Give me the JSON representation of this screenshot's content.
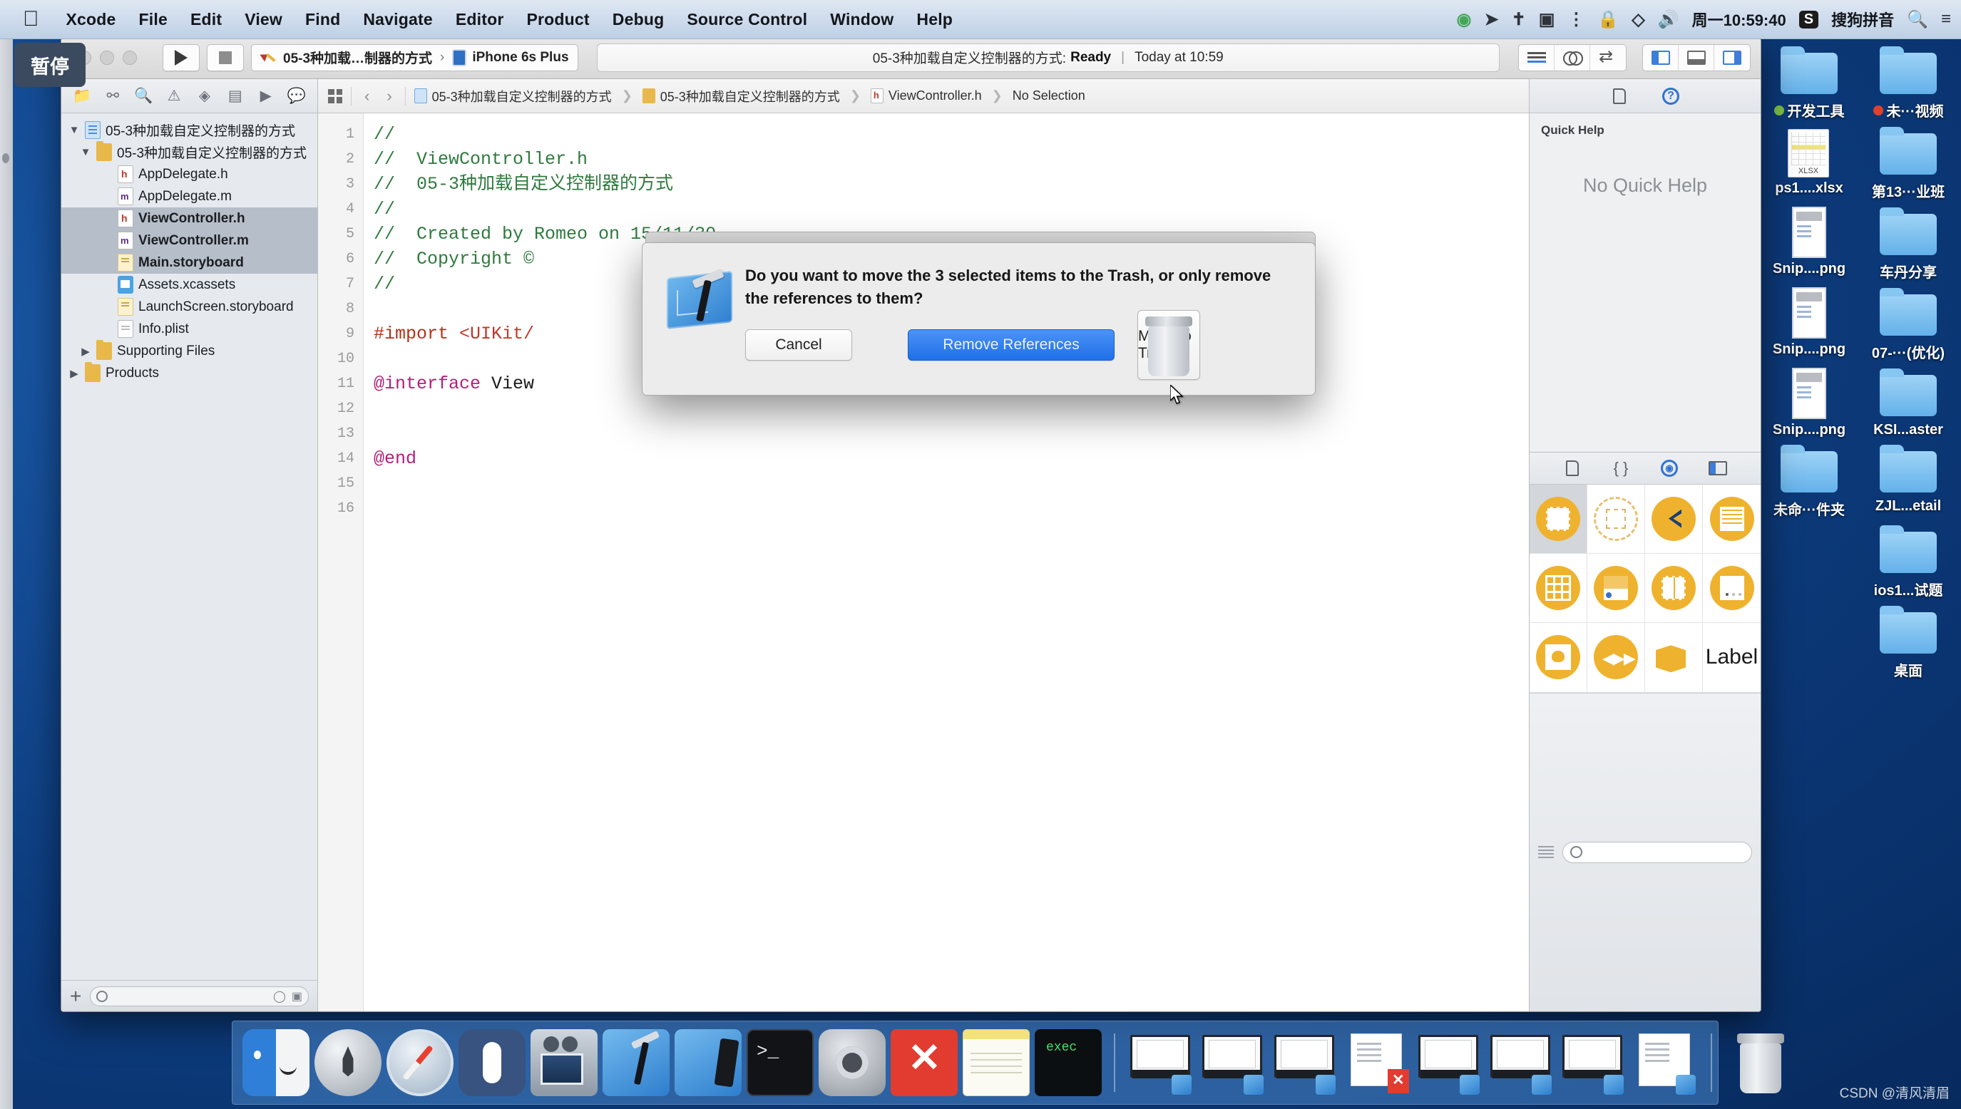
{
  "menubar": {
    "apple_glyph": "",
    "items": [
      "Xcode",
      "File",
      "Edit",
      "View",
      "Find",
      "Navigate",
      "Editor",
      "Product",
      "Debug",
      "Source Control",
      "Window",
      "Help"
    ],
    "status": {
      "record_icon": "record-green-icon",
      "location_icon": "location-arrow-icon",
      "bluetooth_icon": "bluetooth-icon",
      "screenrec_icon": "screen-record-icon",
      "airplay_icon": "airplay-icon",
      "lock_icon": "lock-icon",
      "shield_icon": "shield-icon",
      "volume_icon": "volume-icon",
      "clock": "周一10:59:40",
      "ime_badge": "S",
      "ime_label": "搜狗拼音",
      "search_icon": "search-icon",
      "control_center_icon": "list-icon"
    }
  },
  "pause_badge": {
    "label": "暂停"
  },
  "xcode": {
    "toolbar": {
      "run_icon": "play-triangle-icon",
      "stop_icon": "stop-square-icon",
      "scheme_name": "05-3种加载…制器的方式",
      "scheme_chevron": "›",
      "destination": "iPhone 6s Plus",
      "status_project": "05-3种加载自定义控制器的方式:",
      "status_state": "Ready",
      "status_divider": "|",
      "status_time": "Today at 10:59",
      "editor_standard_icon": "standard-editor-icon",
      "editor_assistant_icon": "assistant-editor-icon",
      "editor_version_icon": "version-editor-icon",
      "toggle_navigator_icon": "toggle-navigator-icon",
      "toggle_debug_icon": "toggle-debug-area-icon",
      "toggle_utilities_icon": "toggle-utilities-icon"
    },
    "navigator": {
      "tabs": [
        "folder-icon",
        "source-control-icon",
        "search-icon",
        "warning-triangle-icon",
        "test-diamond-icon",
        "debug-icon",
        "breakpoint-tag-icon",
        "report-icon"
      ],
      "tree": [
        {
          "label": "05-3种加载自定义控制器的方式",
          "indent": 0,
          "icon": "project",
          "twisty": "▼",
          "selected": false
        },
        {
          "label": "05-3种加载自定义控制器的方式",
          "indent": 1,
          "icon": "folder",
          "twisty": "▼",
          "selected": false
        },
        {
          "label": "AppDelegate.h",
          "indent": 2,
          "icon": "header",
          "twisty": "",
          "selected": false
        },
        {
          "label": "AppDelegate.m",
          "indent": 2,
          "icon": "impl",
          "twisty": "",
          "selected": false
        },
        {
          "label": "ViewController.h",
          "indent": 2,
          "icon": "header",
          "twisty": "",
          "selected": true
        },
        {
          "label": "ViewController.m",
          "indent": 2,
          "icon": "impl",
          "twisty": "",
          "selected": true
        },
        {
          "label": "Main.storyboard",
          "indent": 2,
          "icon": "storyboard",
          "twisty": "",
          "selected": true
        },
        {
          "label": "Assets.xcassets",
          "indent": 2,
          "icon": "xcassets",
          "twisty": "",
          "selected": false
        },
        {
          "label": "LaunchScreen.storyboard",
          "indent": 2,
          "icon": "storyboard",
          "twisty": "",
          "selected": false
        },
        {
          "label": "Info.plist",
          "indent": 2,
          "icon": "plist",
          "twisty": "",
          "selected": false
        },
        {
          "label": "Supporting Files",
          "indent": 1,
          "icon": "folder",
          "twisty": "▶",
          "selected": false
        },
        {
          "label": "Products",
          "indent": 0,
          "icon": "folder",
          "twisty": "▶",
          "selected": false
        }
      ],
      "footer": {
        "add_label": "+",
        "filter_placeholder": "",
        "recent_icon": "clock-icon",
        "source_icon": "source-control-filter-icon"
      }
    },
    "jumpbar": {
      "grid_icon": "related-items-icon",
      "back_icon": "‹",
      "forward_icon": "›",
      "crumbs": [
        "05-3种加载自定义控制器的方式",
        "05-3种加载自定义控制器的方式",
        "ViewController.h",
        "No Selection"
      ],
      "separator": "❯"
    },
    "code": {
      "filename": "ViewController.h",
      "lines": [
        {
          "n": 1,
          "segments": [
            {
              "t": "//",
              "c": "c-cmt"
            }
          ]
        },
        {
          "n": 2,
          "segments": [
            {
              "t": "//  ViewController.h",
              "c": "c-cmt"
            }
          ]
        },
        {
          "n": 3,
          "segments": [
            {
              "t": "//  05-3种加载自定义控制器的方式",
              "c": "c-cmt"
            }
          ]
        },
        {
          "n": 4,
          "segments": [
            {
              "t": "//",
              "c": "c-cmt"
            }
          ]
        },
        {
          "n": 5,
          "segments": [
            {
              "t": "//  Created by Romeo on 15/11/30",
              "c": "c-cmt"
            }
          ]
        },
        {
          "n": 6,
          "segments": [
            {
              "t": "//  Copyright ©",
              "c": "c-cmt"
            }
          ]
        },
        {
          "n": 7,
          "segments": [
            {
              "t": "//",
              "c": "c-cmt"
            }
          ]
        },
        {
          "n": 8,
          "segments": [
            {
              "t": "",
              "c": "c-txt"
            }
          ]
        },
        {
          "n": 9,
          "segments": [
            {
              "t": "#import ",
              "c": "c-pre"
            },
            {
              "t": "<UIKit/",
              "c": "c-str"
            }
          ]
        },
        {
          "n": 10,
          "segments": [
            {
              "t": "",
              "c": "c-txt"
            }
          ]
        },
        {
          "n": 11,
          "segments": [
            {
              "t": "@interface ",
              "c": "c-kw"
            },
            {
              "t": "View",
              "c": "c-txt"
            }
          ]
        },
        {
          "n": 12,
          "segments": [
            {
              "t": "",
              "c": "c-txt"
            }
          ]
        },
        {
          "n": 13,
          "segments": [
            {
              "t": "",
              "c": "c-txt"
            }
          ]
        },
        {
          "n": 14,
          "segments": [
            {
              "t": "@end",
              "c": "c-kw"
            }
          ]
        },
        {
          "n": 15,
          "segments": [
            {
              "t": "",
              "c": "c-txt"
            }
          ]
        },
        {
          "n": 16,
          "segments": [
            {
              "t": "",
              "c": "c-txt"
            }
          ]
        }
      ]
    },
    "utilities": {
      "tabs": [
        "file-inspector-icon",
        "quick-help-icon"
      ],
      "quick_help_title": "Quick Help",
      "quick_help_empty": "No Quick Help",
      "library_tabs": [
        "file-template-library-icon",
        "code-snippet-library-icon",
        "object-library-icon",
        "media-library-icon"
      ],
      "library_objects": [
        {
          "name": "view-controller-object",
          "kind": "viewctrl",
          "selected": true
        },
        {
          "name": "storyboard-reference-object",
          "kind": "dashed",
          "selected": false
        },
        {
          "name": "navigation-controller-object",
          "kind": "navctrl",
          "selected": false
        },
        {
          "name": "table-view-controller-object",
          "kind": "tablectrl",
          "selected": false
        },
        {
          "name": "collection-view-controller-object",
          "kind": "collection",
          "selected": false
        },
        {
          "name": "tab-bar-controller-object",
          "kind": "tabbar",
          "selected": false
        },
        {
          "name": "split-view-controller-object",
          "kind": "split",
          "selected": false
        },
        {
          "name": "page-view-controller-object",
          "kind": "pagectl",
          "selected": false
        },
        {
          "name": "image-view-object",
          "kind": "imageview",
          "selected": false
        },
        {
          "name": "av-player-object",
          "kind": "player",
          "selected": false
        },
        {
          "name": "object-cube",
          "kind": "cube",
          "selected": false
        },
        {
          "name": "label-object",
          "kind": "label",
          "label": "Label",
          "selected": false
        }
      ],
      "library_filter_placeholder": ""
    }
  },
  "dialog": {
    "icon": "xcode-app-icon",
    "message": "Do you want to move the 3 selected items to the Trash, or only remove the references to them?",
    "buttons": {
      "cancel": "Cancel",
      "remove_references": "Remove References",
      "move_to_trash": "Move to Trash"
    },
    "default_button": "Remove References",
    "accent_color": "#2f7fe8"
  },
  "desktop": {
    "icons": [
      {
        "label": "开发工具",
        "type": "folder",
        "dot": "#7fc242"
      },
      {
        "label": "未···视频",
        "type": "folder",
        "dot": "#e2402c"
      },
      {
        "label": "ps1....xlsx",
        "type": "xlsx",
        "dot": ""
      },
      {
        "label": "第13···业班",
        "type": "folder",
        "dot": ""
      },
      {
        "label": "Snip....png",
        "type": "screenshot",
        "dot": ""
      },
      {
        "label": "车丹分享",
        "type": "folder",
        "dot": ""
      },
      {
        "label": "Snip....png",
        "type": "screenshot",
        "dot": ""
      },
      {
        "label": "07-···(优化)",
        "type": "folder",
        "dot": ""
      },
      {
        "label": "Snip....png",
        "type": "screenshot",
        "dot": ""
      },
      {
        "label": "KSI...aster",
        "type": "folder",
        "dot": ""
      },
      {
        "label": "未命···件夹",
        "type": "folder",
        "dot": ""
      },
      {
        "label": "ZJL...etail",
        "type": "folder",
        "dot": ""
      },
      {
        "label": "",
        "type": "blank",
        "dot": ""
      },
      {
        "label": "ios1...试题",
        "type": "folder",
        "dot": ""
      },
      {
        "label": "",
        "type": "blank",
        "dot": ""
      },
      {
        "label": "桌面",
        "type": "folder",
        "dot": ""
      }
    ]
  },
  "dock": {
    "apps": [
      "finder-icon",
      "launchpad-icon",
      "safari-icon",
      "mouse-app-icon",
      "quicktime-icon",
      "xcode-icon",
      "xcode-device-icon",
      "terminal-icon",
      "system-preferences-icon",
      "xmind-icon",
      "notes-icon",
      "exec-terminal-icon"
    ],
    "minimized": [
      "minimized-window-1",
      "minimized-window-2",
      "minimized-window-3",
      "minimized-xmind-doc",
      "minimized-window-4",
      "minimized-window-5",
      "minimized-window-6",
      "minimized-xcode-doc"
    ],
    "trash": "trash-icon"
  },
  "watermark": {
    "text": "CSDN @清风清眉"
  }
}
